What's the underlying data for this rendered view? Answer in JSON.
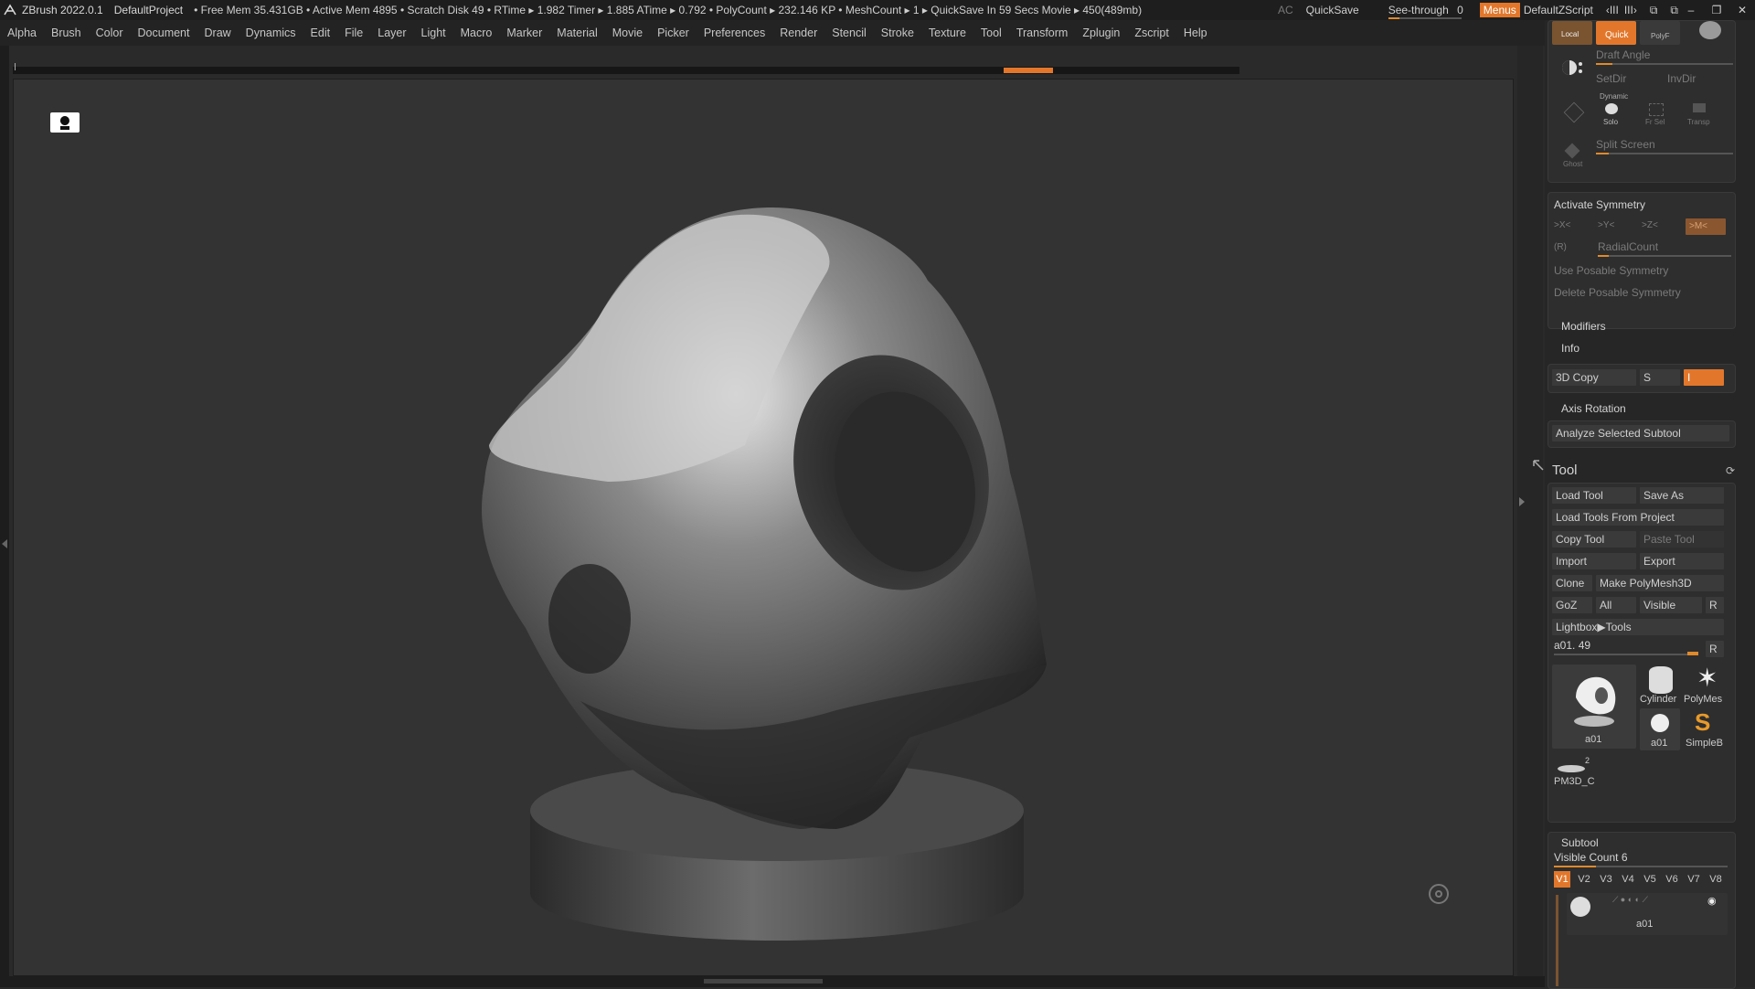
{
  "titlebar": {
    "app": "ZBrush 2022.0.1",
    "project": "DefaultProject",
    "status": "• Free Mem 35.431GB • Active Mem 4895 • Scratch Disk 49 •  RTime ▸ 1.982 Timer ▸ 1.885 ATime ▸ 0.792 • PolyCount ▸ 232.146 KP  • MeshCount ▸ 1  ▸ QuickSave In 59 Secs Movie ▸ 450(489mb)",
    "ac": "AC",
    "quicksave": "QuickSave",
    "seethrough_label": "See-through",
    "seethrough_value": "0",
    "seethrough_fraction": 0.0,
    "menus": "Menus",
    "zscript": "DefaultZScript"
  },
  "menubar": [
    "Alpha",
    "Brush",
    "Color",
    "Document",
    "Draw",
    "Dynamics",
    "Edit",
    "File",
    "Layer",
    "Light",
    "Macro",
    "Marker",
    "Material",
    "Movie",
    "Picker",
    "Preferences",
    "Render",
    "Stencil",
    "Stroke",
    "Texture",
    "Tool",
    "Transform",
    "Zplugin",
    "Zscript",
    "Help"
  ],
  "topbuttons": {
    "local": "Local",
    "quick": "Quick",
    "polyf": "PolyF",
    "draft_angle": "Draft Angle",
    "setdir": "SetDir",
    "invdir": "InvDir",
    "dynamic": "Dynamic",
    "solo": "Solo",
    "frsel": "Fr Sel",
    "transp": "Transp",
    "split_screen": "Split Screen",
    "ghost": "Ghost"
  },
  "symmetry": {
    "activate": "Activate Symmetry",
    "x": ">X<",
    "y": ">Y<",
    "z": ">Z<",
    "m": ">M<",
    "r": "(R)",
    "radial_count": "RadialCount",
    "use_posable": "Use Posable Symmetry",
    "delete_posable": "Delete Posable Symmetry"
  },
  "modifiers": "Modifiers",
  "info": "Info",
  "copy3d": {
    "label": "3D Copy",
    "s": "S",
    "i": "I"
  },
  "axis_rotation": "Axis Rotation",
  "analyze": "Analyze Selected Subtool",
  "tool": {
    "title": "Tool",
    "load_tool": "Load Tool",
    "save_as": "Save As",
    "load_from_project": "Load Tools From Project",
    "copy_tool": "Copy Tool",
    "paste_tool": "Paste Tool",
    "import": "Import",
    "export": "Export",
    "clone": "Clone",
    "make_polymesh": "Make PolyMesh3D",
    "goz": "GoZ",
    "all": "All",
    "visible": "Visible",
    "r": "R",
    "lightbox": "Lightbox▶Tools",
    "current": "a01. 49",
    "current_r": "R",
    "thumbs": {
      "main": "a01",
      "cylinder": "Cylinder",
      "polymesh": "PolyMes",
      "a01small": "a01",
      "simpleb": "SimpleB",
      "pm3d": "PM3D_C",
      "pm3d_count": "2"
    }
  },
  "subtool": {
    "title": "Subtool",
    "visible_count": "Visible Count 6",
    "tabs": [
      "V1",
      "V2",
      "V3",
      "V4",
      "V5",
      "V6",
      "V7",
      "V8"
    ],
    "item_name": "a01"
  },
  "colors": {
    "accent": "#e2772b",
    "panel": "#262626",
    "canvas": "#333333"
  }
}
